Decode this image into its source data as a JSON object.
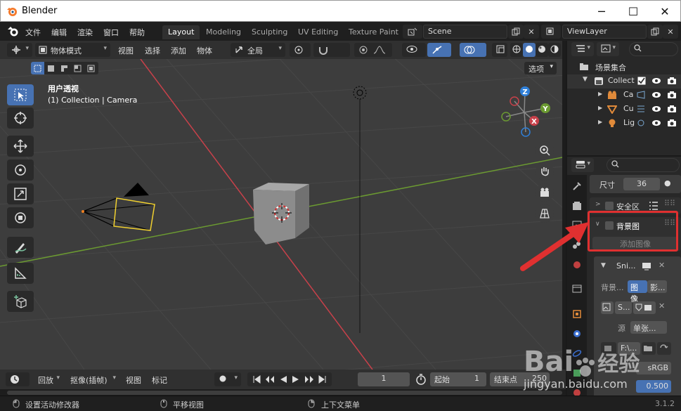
{
  "window": {
    "title": "Blender",
    "controls": [
      "─",
      "☐",
      "✕"
    ]
  },
  "menus": [
    "文件",
    "编辑",
    "渲染",
    "窗口",
    "帮助"
  ],
  "workspaces": [
    "Layout",
    "Modeling",
    "Sculpting",
    "UV Editing",
    "Texture Paint"
  ],
  "scene": {
    "value": "Scene"
  },
  "viewlayer": {
    "value": "ViewLayer"
  },
  "viewport_header": {
    "mode": "物体模式",
    "menus": [
      "视图",
      "选择",
      "添加",
      "物体"
    ],
    "orientation": "全局",
    "options": "选项"
  },
  "viewport": {
    "overlay_line1": "用户透视",
    "overlay_line2": "(1) Collection | Camera",
    "gizmo": {
      "z": "Z",
      "y": "Y",
      "x": "X"
    }
  },
  "outliner": {
    "root": "场景集合",
    "collection": "Collect",
    "items": [
      "Ca",
      "Cu",
      "Lig"
    ]
  },
  "properties": {
    "size_label": "尺寸",
    "size_value": "36",
    "safe_areas": "安全区",
    "background_images": "背景图",
    "add_image": "添加图像",
    "image_name": "Sni...",
    "source_label": "背景...",
    "source_image": "图像",
    "source_clip": "影...",
    "s_btn": "S...",
    "source2_label": "源",
    "source2_value": "单张...",
    "filepath": "F:\\...",
    "colorspace": "sRGB",
    "alpha": "0.500"
  },
  "timeline": {
    "playback": "回放",
    "keying": "抠像(插帧)",
    "view": "视图",
    "marker": "标记",
    "current_frame": "1",
    "start_label": "起始",
    "start_value": "1",
    "end_label": "结束点",
    "end_value": "250"
  },
  "status": {
    "left": "设置活动修改器",
    "mid": "平移视图",
    "right": "上下文菜单",
    "version": "3.1.2"
  },
  "watermark": {
    "brand": "Bai",
    "brand2": "经验",
    "url": "jingyan.baidu.com"
  },
  "colors": {
    "accent": "#4772b3",
    "annotation_red": "#e03030",
    "x_axis": "#c8414a",
    "y_axis": "#6b9a31"
  }
}
